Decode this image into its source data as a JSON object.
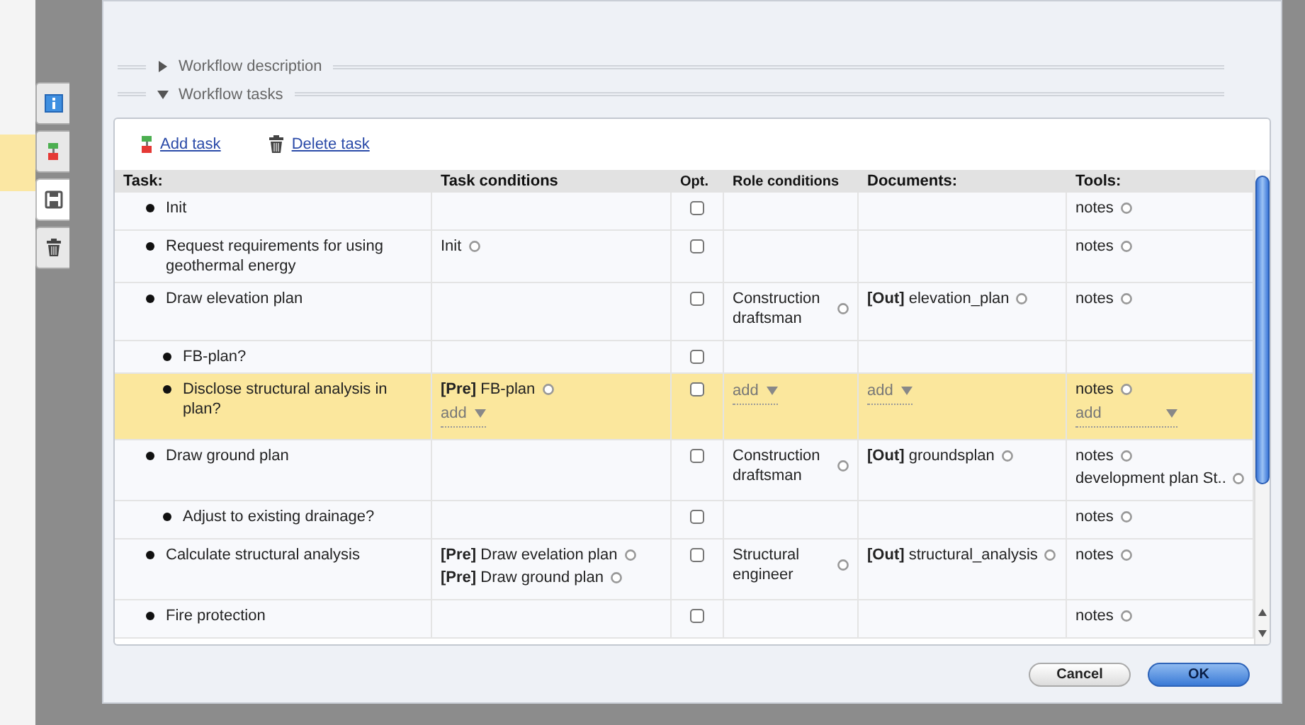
{
  "side_tabs": [
    {
      "kind": "info",
      "selected": false
    },
    {
      "kind": "tree",
      "selected": false
    },
    {
      "kind": "save",
      "selected": true
    },
    {
      "kind": "trash",
      "selected": false
    }
  ],
  "sections": [
    {
      "label": "Workflow description",
      "expanded": false
    },
    {
      "label": "Workflow tasks",
      "expanded": true
    }
  ],
  "toolbar": [
    {
      "kind": "add",
      "label": "Add task"
    },
    {
      "kind": "delete",
      "label": "Delete task"
    }
  ],
  "table": {
    "columns": [
      "Task:",
      "Task conditions",
      "Opt.",
      "Role conditions",
      "Documents:",
      "Tools:"
    ],
    "rows": [
      {
        "task": "Init",
        "selected": false,
        "optional": false,
        "tools": [
          "notes"
        ]
      },
      {
        "task": "Request requirements for using geothermal energy",
        "selected": false,
        "optional": false,
        "conditions": [
          "Init"
        ],
        "tools": [
          "notes"
        ]
      },
      {
        "task": "Draw elevation plan",
        "selected": false,
        "optional": false,
        "roles": [
          "Construction draftsman"
        ],
        "documents": [
          "**[Out]** elevation_plan"
        ],
        "tools": [
          "notes"
        ],
        "children": [
          {
            "task": "FB-plan?",
            "selected": false,
            "optional": false
          },
          {
            "task": "Disclose structural analysis in plan?",
            "selected": true,
            "optional": false,
            "conditions": [
              "**[Pre]** FB-plan"
            ],
            "conditions_add": "add",
            "roles_add": "add",
            "documents_add": "add",
            "tools": [
              "notes"
            ],
            "tools_add": "add"
          }
        ]
      },
      {
        "task": "Draw ground plan",
        "selected": false,
        "optional": false,
        "roles": [
          "Construction draftsman"
        ],
        "documents": [
          "**[Out]** groundsplan"
        ],
        "tools": [
          "notes",
          "development plan St.."
        ],
        "children": [
          {
            "task": "Adjust to existing drainage?",
            "selected": false,
            "optional": false,
            "tools": [
              "notes"
            ]
          }
        ]
      },
      {
        "task": "Calculate structural analysis",
        "selected": false,
        "optional": false,
        "conditions": [
          "**[Pre]** Draw evelation plan",
          "**[Pre]** Draw ground plan"
        ],
        "roles": [
          "Structural engineer"
        ],
        "documents": [
          "**[Out]** structural_analysis"
        ],
        "tools": [
          "notes"
        ]
      },
      {
        "task": "Fire protection",
        "selected": false,
        "optional": false,
        "tools": [
          "notes"
        ]
      }
    ]
  },
  "buttons": [
    {
      "label": "Cancel",
      "primary": false
    },
    {
      "label": "OK",
      "primary": true
    }
  ]
}
